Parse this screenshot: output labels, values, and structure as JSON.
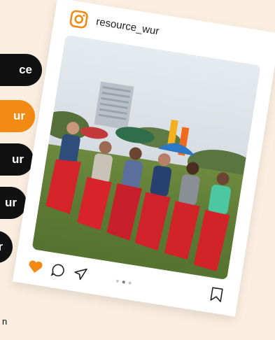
{
  "nav": {
    "items": [
      {
        "label": "ce"
      },
      {
        "label": "ur"
      },
      {
        "label": "ur"
      },
      {
        "label": "ur"
      },
      {
        "label": "ur"
      }
    ],
    "footer_letter": "n"
  },
  "post": {
    "username": "resource_wur",
    "carousel": {
      "count": 3,
      "active": 2
    }
  },
  "colors": {
    "accent": "#f28a13",
    "dark": "#111111",
    "background": "#faeee0",
    "like": "#f28a13"
  },
  "icons": [
    "instagram-icon",
    "heart-icon",
    "comment-icon",
    "share-icon",
    "bookmark-icon"
  ]
}
